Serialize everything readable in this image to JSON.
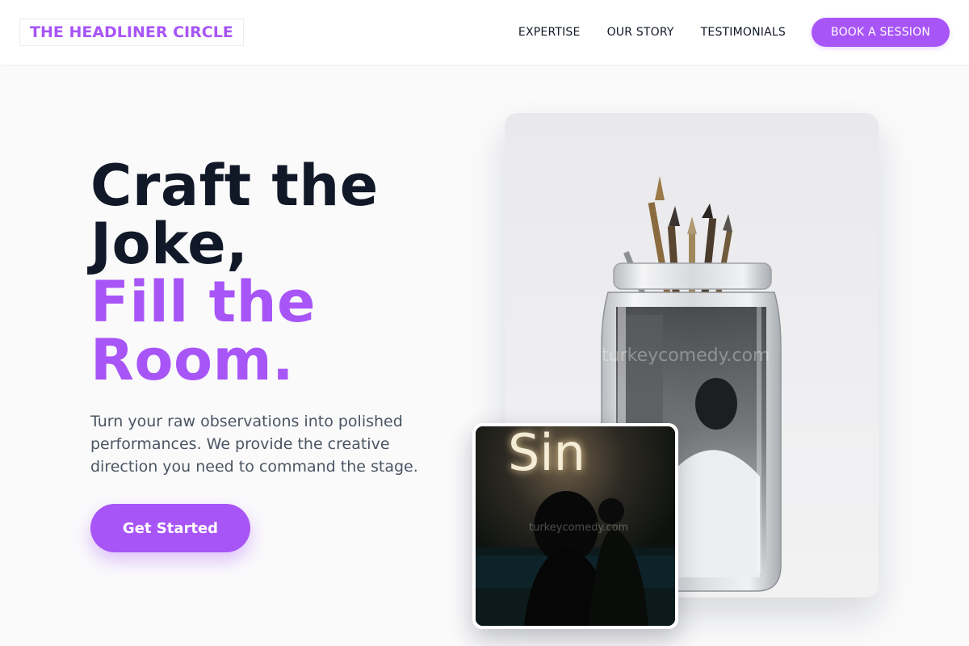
{
  "nav": {
    "brand": "THE HEADLINER CIRCLE",
    "links": [
      "EXPERTISE",
      "OUR STORY",
      "TESTIMONIALS"
    ],
    "cta": "BOOK A SESSION"
  },
  "hero": {
    "heading_dark": [
      "Craft the",
      "Joke,"
    ],
    "heading_accent": [
      "Fill the",
      "Room."
    ],
    "description": "Turn your raw observations into polished performances. We provide the creative direction you need to command the stage.",
    "cta": "Get Started"
  },
  "images": {
    "main": {
      "subject": "glass jar with brushes and black-and-white photo",
      "watermark": "turkeycomedy.com"
    },
    "inset": {
      "subject": "silhouette in front of neon sign",
      "neon_text": "Sin",
      "watermark": "turkeycomedy.com"
    }
  },
  "colors": {
    "accent": "#a855f7",
    "heading": "#111827",
    "body_text": "#4b5563",
    "background": "#fafafb"
  }
}
